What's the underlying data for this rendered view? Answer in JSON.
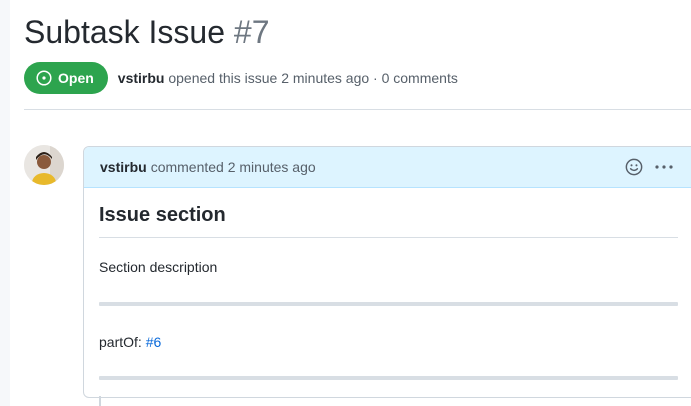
{
  "issue": {
    "title": "Subtask Issue",
    "number": "#7",
    "state_label": "Open",
    "author": "vstirbu",
    "meta_suffix": "opened this issue 2 minutes ago · 0 comments"
  },
  "comment": {
    "author": "vstirbu",
    "action": "commented 2 minutes ago",
    "heading": "Issue section",
    "description": "Section description",
    "partof_label": "partOf:",
    "partof_link": "#6"
  },
  "icons": {
    "state": "issue-opened-icon",
    "reaction": "smiley-icon",
    "menu": "kebab-horizontal-icon"
  },
  "colors": {
    "open_green": "#2da44e",
    "link_blue": "#0969da",
    "header_bg": "#ddf4ff"
  }
}
